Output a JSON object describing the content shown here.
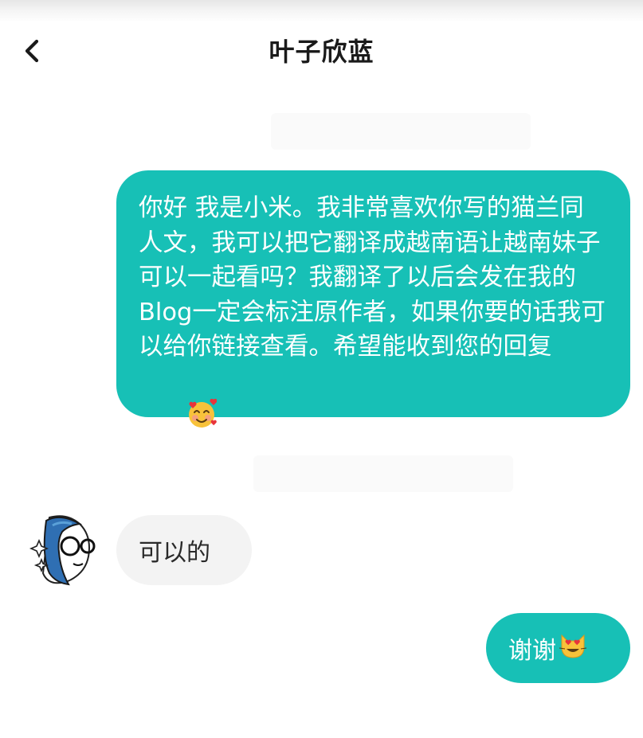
{
  "header": {
    "back_icon": "chevron-left-icon",
    "title": "叶子欣蓝"
  },
  "messages": [
    {
      "direction": "outgoing",
      "text": "你好 我是小米。我非常喜欢你写的猫兰同人文，我可以把它翻译成越南语让越南妹子可以一起看吗？我翻译了以后会发在我的Blog一定会标注原作者，如果你要的话我可以给你链接查看。希望能收到您的回复",
      "emoji": "smiling-face-with-hearts-icon"
    },
    {
      "direction": "incoming",
      "sender_avatar": "avatar-girl-glasses-icon",
      "text": "可以的"
    },
    {
      "direction": "outgoing",
      "text": "谢谢",
      "emoji": "heart-eyes-cat-icon"
    }
  ],
  "colors": {
    "outgoing_bubble": "#17c0b6",
    "incoming_bubble": "#f3f3f3",
    "title_text": "#1a1a1a"
  }
}
